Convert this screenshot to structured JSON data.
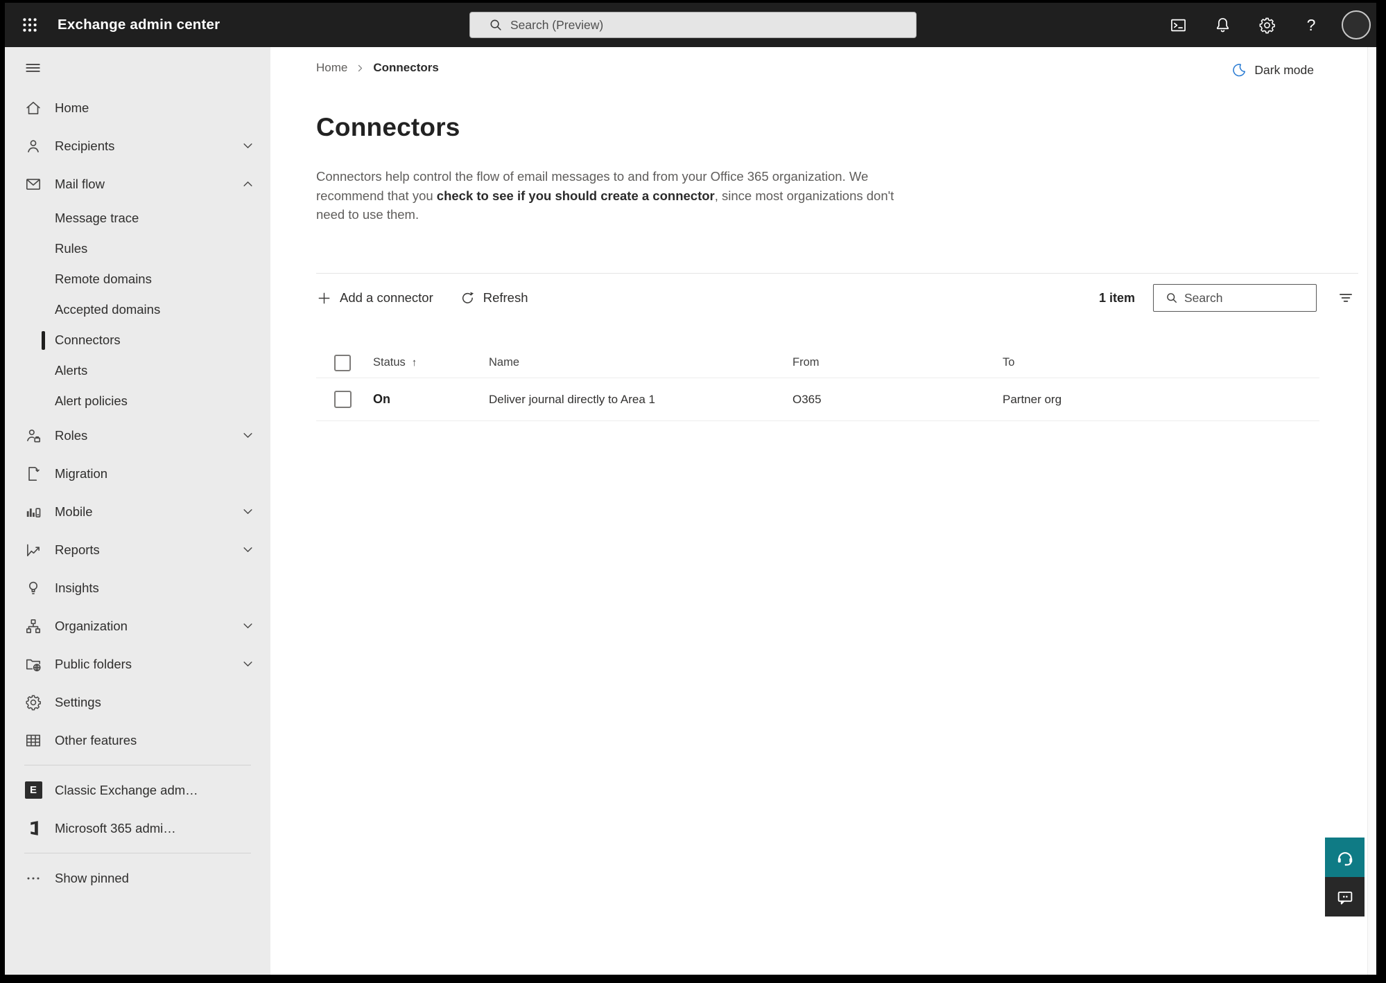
{
  "colors": {
    "top_bar_bg": "#1f1f1f",
    "sidebar_bg": "#ebebeb",
    "accent_teal": "#0f7b85",
    "moon_blue": "#2b7cd3",
    "chat_button_bg": "#282828",
    "selected_indicator": "#1f1f1e"
  },
  "top_bar": {
    "title": "Exchange admin center",
    "search_placeholder": "Search (Preview)",
    "help_glyph": "?",
    "icons": [
      "app-launcher",
      "terminal",
      "notifications-bell",
      "settings-gear",
      "help",
      "account-avatar"
    ]
  },
  "sidebar": {
    "items": [
      {
        "label": "Home",
        "icon": "home"
      },
      {
        "label": "Recipients",
        "icon": "person",
        "chevron": "down"
      },
      {
        "label": "Mail flow",
        "icon": "mail",
        "chevron": "up",
        "expanded": true
      },
      {
        "label": "Roles",
        "icon": "person-briefcase",
        "chevron": "down"
      },
      {
        "label": "Migration",
        "icon": "document-arrow"
      },
      {
        "label": "Mobile",
        "icon": "chart-phone",
        "chevron": "down"
      },
      {
        "label": "Reports",
        "icon": "line-chart",
        "chevron": "down"
      },
      {
        "label": "Insights",
        "icon": "lightbulb"
      },
      {
        "label": "Organization",
        "icon": "org-chart",
        "chevron": "down"
      },
      {
        "label": "Public folders",
        "icon": "folder-globe",
        "chevron": "down"
      },
      {
        "label": "Settings",
        "icon": "gear"
      },
      {
        "label": "Other features",
        "icon": "table-grid"
      }
    ],
    "mail_flow_children": [
      {
        "label": "Message trace"
      },
      {
        "label": "Rules"
      },
      {
        "label": "Remote domains"
      },
      {
        "label": "Accepted domains"
      },
      {
        "label": "Connectors",
        "selected": true
      },
      {
        "label": "Alerts"
      },
      {
        "label": "Alert policies"
      }
    ],
    "footer_items": [
      {
        "label": "Classic Exchange adm…",
        "icon": "exchange-logo",
        "logo_letter": "E"
      },
      {
        "label": "Microsoft 365 admi…",
        "icon": "microsoft-365-logo"
      }
    ],
    "show_pinned_label": "Show pinned"
  },
  "main": {
    "breadcrumb": {
      "home": "Home",
      "current": "Connectors"
    },
    "dark_mode_label": "Dark mode",
    "page_title": "Connectors",
    "description": {
      "part1": "Connectors help control the flow of email messages to and from your Office 365 organization. We recommend that you ",
      "bold": "check to see if you should create a connector",
      "part2": ", since most organizations don't need to use them."
    },
    "toolbar": {
      "add_label": "Add a connector",
      "refresh_label": "Refresh",
      "item_count": "1 item",
      "search_placeholder": "Search"
    },
    "table": {
      "columns": {
        "status": "Status",
        "name": "Name",
        "from": "From",
        "to": "To"
      },
      "sort_column": "Status",
      "sort_direction": "ascending",
      "sort_indicator": "↑",
      "rows": [
        {
          "status": "On",
          "name": "Deliver journal directly to Area 1",
          "from": "O365",
          "to": "Partner org"
        }
      ]
    }
  }
}
